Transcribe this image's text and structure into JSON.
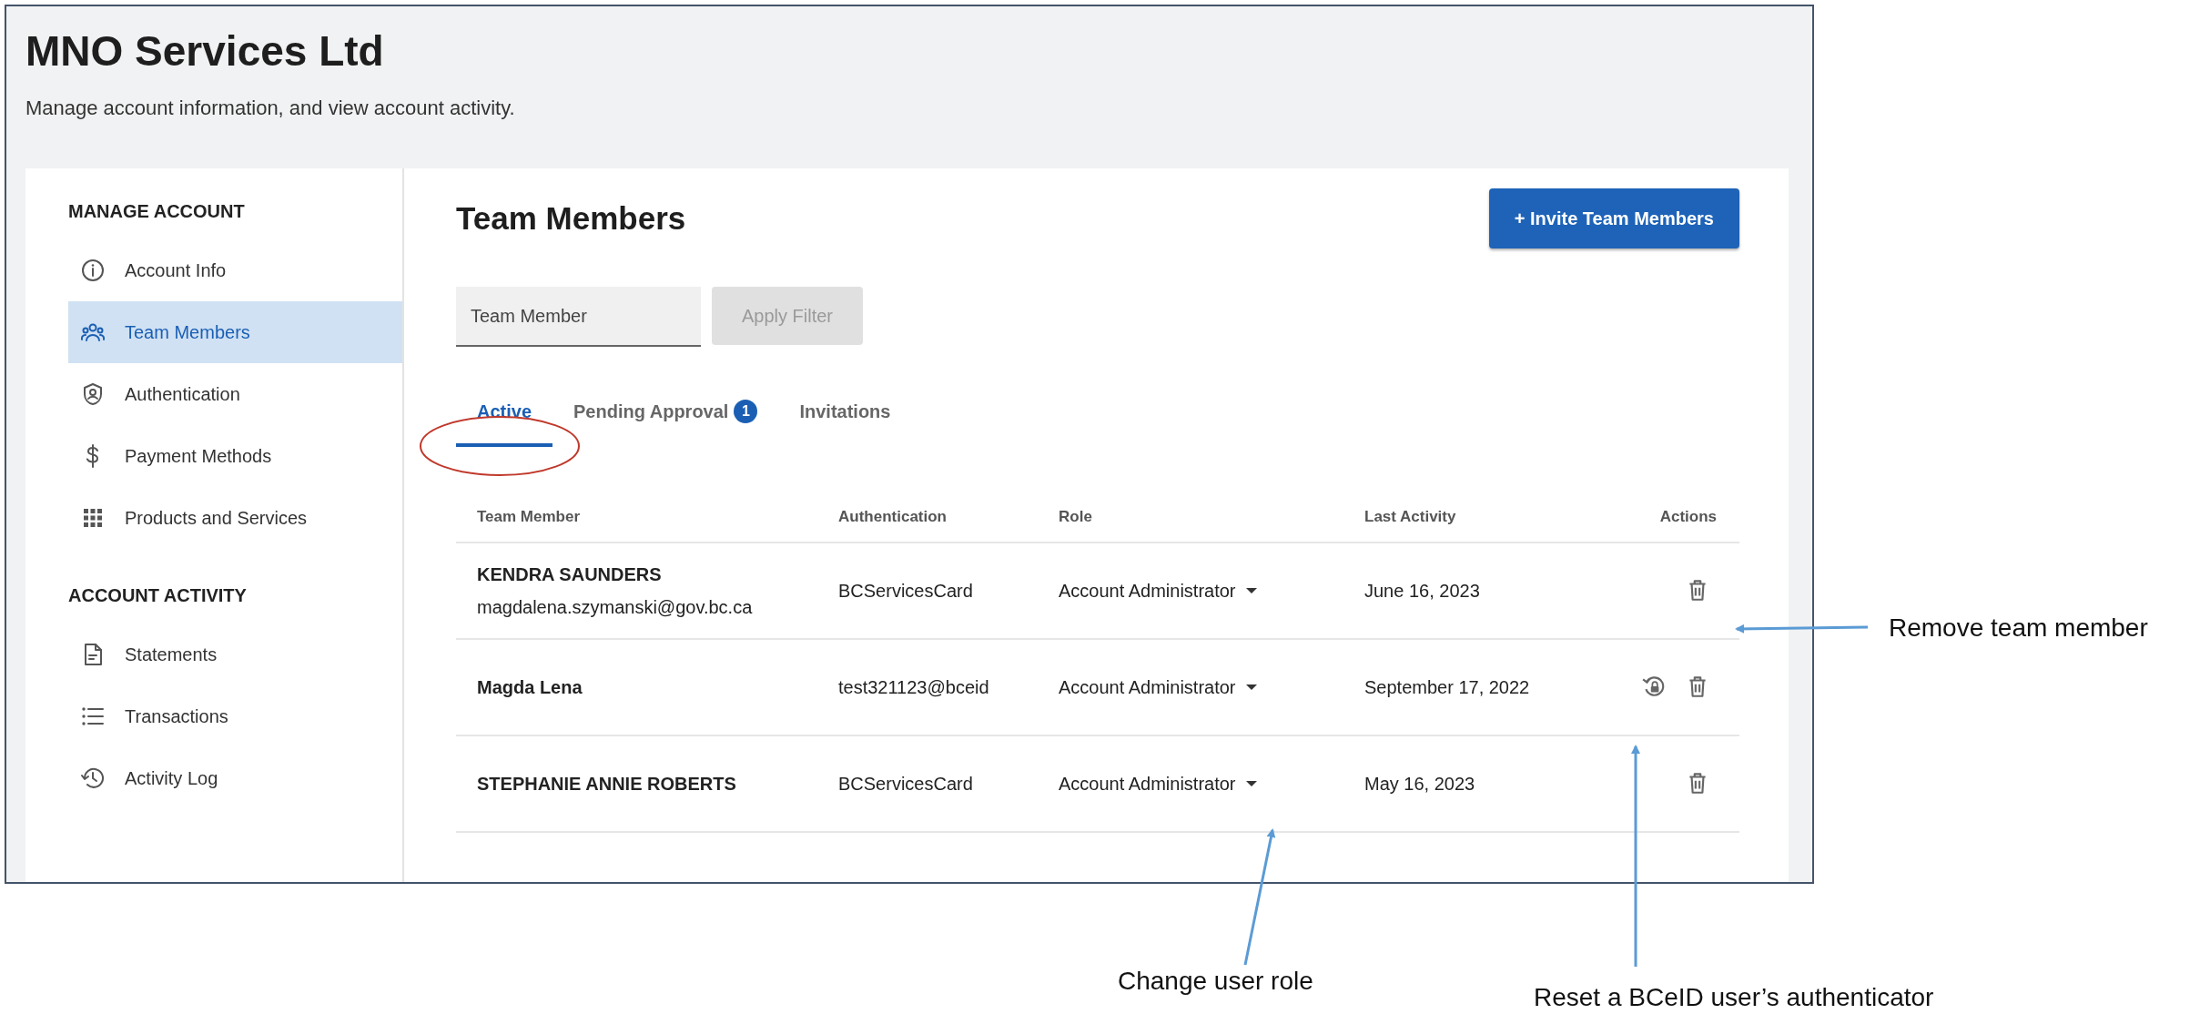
{
  "header": {
    "title": "MNO Services Ltd",
    "subtitle": "Manage account information, and view account activity."
  },
  "sidebar": {
    "sections": [
      {
        "heading": "MANAGE ACCOUNT",
        "items": [
          {
            "label": "Account Info",
            "selected": false
          },
          {
            "label": "Team Members",
            "selected": true
          },
          {
            "label": "Authentication",
            "selected": false
          },
          {
            "label": "Payment Methods",
            "selected": false
          },
          {
            "label": "Products and Services",
            "selected": false
          }
        ]
      },
      {
        "heading": "ACCOUNT ACTIVITY",
        "items": [
          {
            "label": "Statements",
            "selected": false
          },
          {
            "label": "Transactions",
            "selected": false
          },
          {
            "label": "Activity Log",
            "selected": false
          }
        ]
      }
    ]
  },
  "main": {
    "title": "Team Members",
    "invite_button": "+ Invite Team Members",
    "filter": {
      "placeholder": "Team Member",
      "apply_button": "Apply Filter",
      "disabled": true
    },
    "tabs": [
      {
        "label": "Active",
        "selected": true
      },
      {
        "label": "Pending Approval",
        "badge": "1",
        "selected": false
      },
      {
        "label": "Invitations",
        "selected": false
      }
    ],
    "table": {
      "columns": [
        "Team Member",
        "Authentication",
        "Role",
        "Last Activity",
        "Actions"
      ],
      "rows": [
        {
          "name": "KENDRA SAUNDERS",
          "email": "magdalena.szymanski@gov.bc.ca",
          "authentication": "BCServicesCard",
          "role": "Account Administrator",
          "last_activity": "June 16, 2023",
          "actions": [
            {
              "kind": "delete"
            }
          ]
        },
        {
          "name": "Magda Lena",
          "authentication": "test321123@bceid",
          "role": "Account Administrator",
          "last_activity": "September 17, 2022",
          "actions": [
            {
              "kind": "reset"
            },
            {
              "kind": "delete"
            }
          ]
        },
        {
          "name": "STEPHANIE ANNIE ROBERTS",
          "authentication": "BCServicesCard",
          "role": "Account Administrator",
          "last_activity": "May 16, 2023",
          "actions": [
            {
              "kind": "delete"
            }
          ]
        }
      ]
    }
  },
  "annotations": [
    {
      "kind": "ellipse"
    },
    {
      "kind": "callout",
      "text": "Remove team member"
    },
    {
      "kind": "callout",
      "text": "Change user role"
    },
    {
      "kind": "callout",
      "text": "Reset a BCeID user’s authenticator"
    }
  ]
}
